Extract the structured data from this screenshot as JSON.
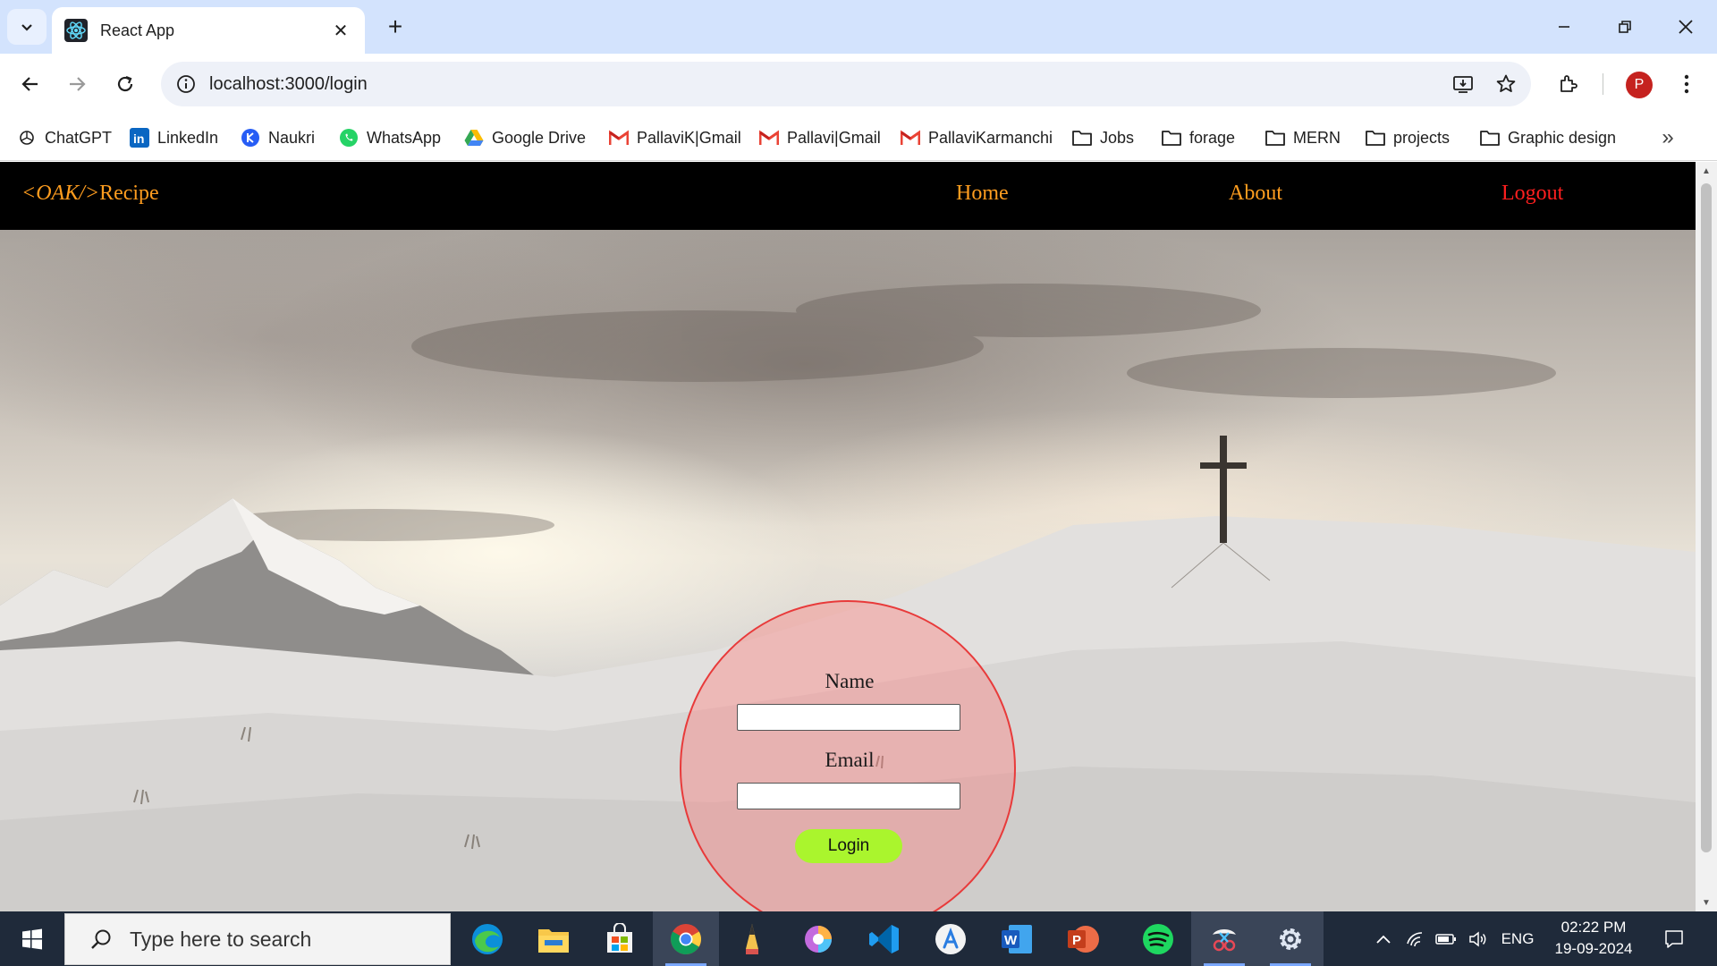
{
  "browser": {
    "tab_title": "React App",
    "url": "localhost:3000/login",
    "profile_initial": "P",
    "bookmarks": [
      {
        "label": "ChatGPT",
        "icon": "chatgpt-icon"
      },
      {
        "label": "LinkedIn",
        "icon": "linkedin-icon"
      },
      {
        "label": "Naukri",
        "icon": "naukri-icon"
      },
      {
        "label": "WhatsApp",
        "icon": "whatsapp-icon"
      },
      {
        "label": "Google Drive",
        "icon": "google-drive-icon"
      },
      {
        "label": "PallaviK|Gmail",
        "icon": "gmail-icon"
      },
      {
        "label": "Pallavi|Gmail",
        "icon": "gmail-icon"
      },
      {
        "label": "PallaviKarmanchi",
        "icon": "gmail-icon"
      },
      {
        "label": "Jobs",
        "icon": "folder-icon"
      },
      {
        "label": "forage",
        "icon": "folder-icon"
      },
      {
        "label": "MERN",
        "icon": "folder-icon"
      },
      {
        "label": "projects",
        "icon": "folder-icon"
      },
      {
        "label": "Graphic design",
        "icon": "folder-icon"
      }
    ]
  },
  "site": {
    "brand_tag": "<OAK/>",
    "brand_name": "Recipe",
    "nav": {
      "home": "Home",
      "about": "About",
      "logout": "Logout"
    },
    "colors": {
      "nav_bg": "#000000",
      "nav_link": "#ff9d1f",
      "logout": "#ff1f1f",
      "login_button": "#aaf52d",
      "circle_border": "#e83a3a"
    }
  },
  "login_form": {
    "name_label": "Name",
    "name_value": "",
    "email_label": "Email",
    "email_value": "",
    "submit_label": "Login"
  },
  "taskbar": {
    "search_placeholder": "Type here to search",
    "language": "ENG",
    "time": "02:22 PM",
    "date": "19-09-2024",
    "apps": [
      "edge-icon",
      "file-explorer-icon",
      "microsoft-store-icon",
      "chrome-icon",
      "pencil-app-icon",
      "paint-app-icon",
      "vscode-icon",
      "app-store-icon",
      "word-icon",
      "powerpoint-icon",
      "spotify-icon",
      "snipping-tool-icon",
      "settings-icon"
    ]
  }
}
